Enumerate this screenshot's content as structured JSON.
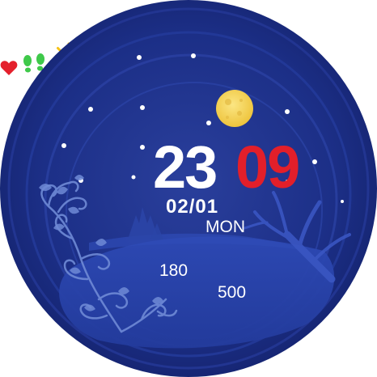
{
  "watch": {
    "time": {
      "hours": "23",
      "minutes": "09"
    },
    "date": "02/01",
    "weekday": "MON",
    "heart_rate": "180",
    "steps": "500",
    "colors": {
      "background": "#1b2f86",
      "hours": "#ffffff",
      "minutes": "#e21f2a",
      "moon": "#f5d55a",
      "sun": "#f6c216",
      "heart": "#e4202c",
      "steps": "#3fc94a"
    },
    "icons": {
      "heart": "heart-icon",
      "steps": "footsteps-icon",
      "weather": "sun-icon",
      "moon": "moon-decoration"
    }
  }
}
